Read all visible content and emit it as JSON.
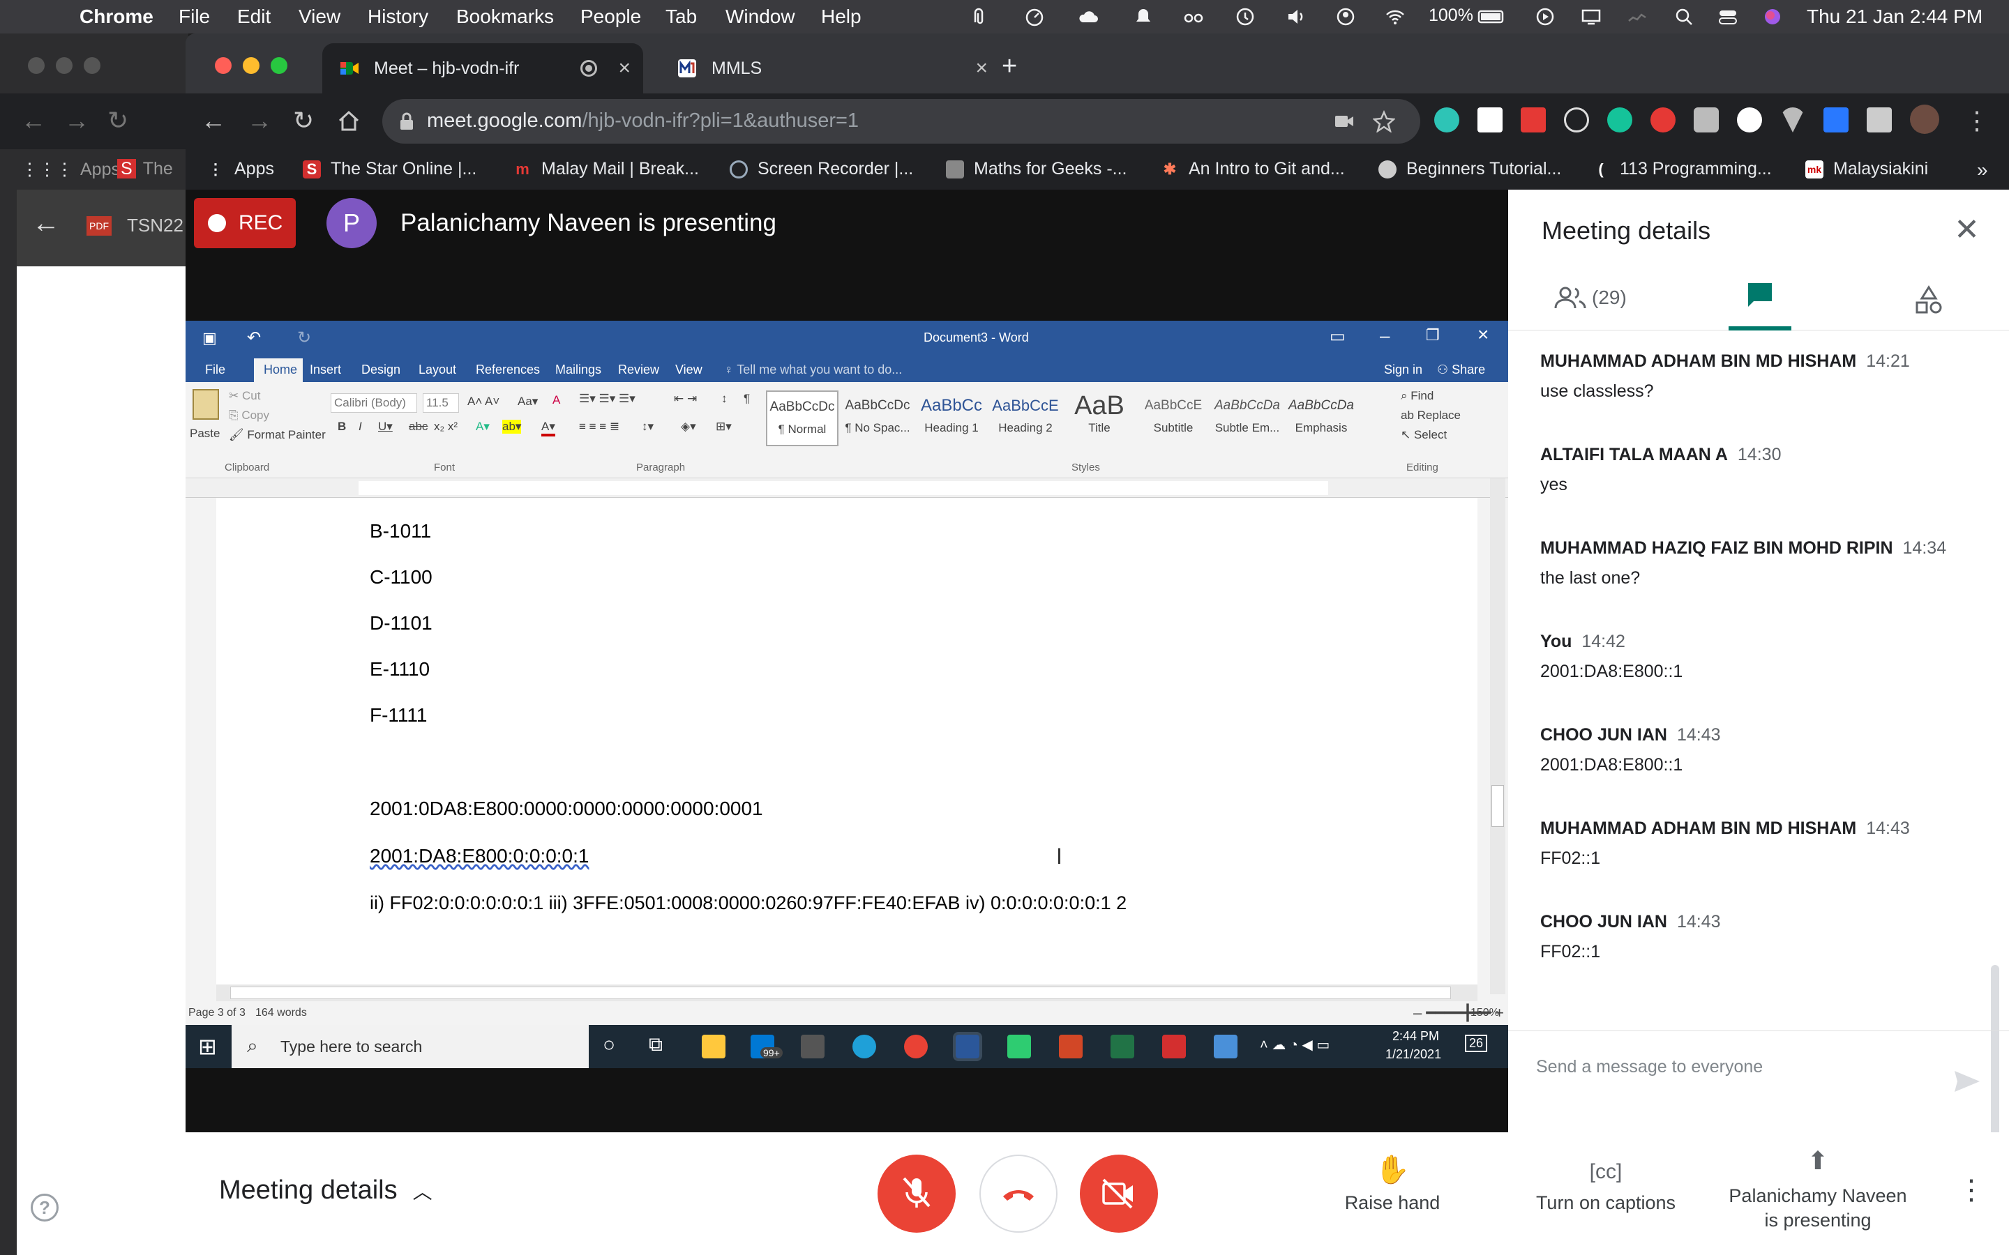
{
  "menubar": {
    "apple": "",
    "items": [
      "Chrome",
      "File",
      "Edit",
      "View",
      "History",
      "Bookmarks",
      "People",
      "Tab",
      "Window",
      "Help"
    ],
    "battery": "100%",
    "datetime": "Thu 21 Jan  2:44 PM"
  },
  "chrome": {
    "tabs": [
      {
        "title": "Meet – hjb-vodn-ifr"
      },
      {
        "title": "MMLS"
      }
    ],
    "back_window_label": "TSN22",
    "url_host": "meet.google.com",
    "url_path": "/hjb-vodn-ifr?pli=1&authuser=1",
    "bookmarks": [
      "Apps",
      "The Star Online |...",
      "Malay Mail | Break...",
      "Screen Recorder |...",
      "Maths for Geeks -...",
      "An Intro to Git and...",
      "Beginners Tutorial...",
      "113 Programming...",
      "Malaysiakini"
    ],
    "back_window_bookmarks": [
      "Apps",
      "The"
    ]
  },
  "meet": {
    "rec_label": "REC",
    "presenter_initial": "P",
    "presenting_text": "Palanichamy Naveen is presenting"
  },
  "word": {
    "title": "Document3 - Word",
    "tabs": [
      "File",
      "Home",
      "Insert",
      "Design",
      "Layout",
      "References",
      "Mailings",
      "Review",
      "View"
    ],
    "tell_me": "Tell me what you want to do...",
    "sign_in": "Sign in",
    "share": "Share",
    "clipboard": {
      "paste": "Paste",
      "cut": "Cut",
      "copy": "Copy",
      "format_painter": "Format Painter",
      "label": "Clipboard"
    },
    "font": {
      "name": "Calibri (Body)",
      "size": "11.5",
      "label": "Font"
    },
    "paragraph_label": "Paragraph",
    "styles": [
      {
        "sample": "AaBbCcDc",
        "name": "¶ Normal"
      },
      {
        "sample": "AaBbCcDc",
        "name": "¶ No Spac..."
      },
      {
        "sample": "AaBbCc",
        "name": "Heading 1"
      },
      {
        "sample": "AaBbCcE",
        "name": "Heading 2"
      },
      {
        "sample": "AaB",
        "name": "Title"
      },
      {
        "sample": "AaBbCcE",
        "name": "Subtitle"
      },
      {
        "sample": "AaBbCcDa",
        "name": "Subtle Em..."
      },
      {
        "sample": "AaBbCcDa",
        "name": "Emphasis"
      }
    ],
    "styles_label": "Styles",
    "editing": {
      "find": "Find",
      "replace": "Replace",
      "select": "Select",
      "label": "Editing"
    },
    "doc_lines": [
      "B-1011",
      "C-1100",
      "D-1101",
      "E-1110",
      "F-1111",
      "2001:0DA8:E800:0000:0000:0000:0000:0001",
      "2001:DA8:E800:0:0:0:0:1",
      "ii) FF02:0:0:0:0:0:0:1 iii) 3FFE:0501:0008:0000:0260:97FF:FE40:EFAB iv) 0:0:0:0:0:0:0:1 2"
    ],
    "status_page": "Page 3 of 3",
    "status_words": "164 words",
    "zoom": "150%"
  },
  "taskbar": {
    "search_placeholder": "Type here to search",
    "mail_badge": "99+",
    "time": "2:44 PM",
    "date": "1/21/2021",
    "notif_count": "26"
  },
  "panel": {
    "title": "Meeting details",
    "people_count": "(29)",
    "messages": [
      {
        "sender": "MUHAMMAD ADHAM BIN MD HISHAM",
        "time": "14:21",
        "text": "use classless?"
      },
      {
        "sender": "ALTAIFI TALA MAAN A",
        "time": "14:30",
        "text": "yes"
      },
      {
        "sender": "MUHAMMAD HAZIQ FAIZ BIN MOHD RIPIN",
        "time": "14:34",
        "text": "the last one?"
      },
      {
        "sender": "You",
        "time": "14:42",
        "text": "2001:DA8:E800::1"
      },
      {
        "sender": "CHOO JUN IAN",
        "time": "14:43",
        "text": "2001:DA8:E800::1"
      },
      {
        "sender": "MUHAMMAD ADHAM BIN MD HISHAM",
        "time": "14:43",
        "text": "FF02::1"
      },
      {
        "sender": "CHOO JUN IAN",
        "time": "14:43",
        "text": "FF02::1"
      }
    ],
    "compose_placeholder": "Send a message to everyone"
  },
  "bottom": {
    "meeting_details": "Meeting details",
    "raise_hand": "Raise hand",
    "captions": "Turn on captions",
    "presenting_line1": "Palanichamy Naveen",
    "presenting_line2": "is presenting"
  },
  "colors": {
    "meet_red": "#ea4335",
    "rec_red": "#c5221f",
    "word_blue": "#2b579a",
    "meet_green": "#00796b"
  }
}
